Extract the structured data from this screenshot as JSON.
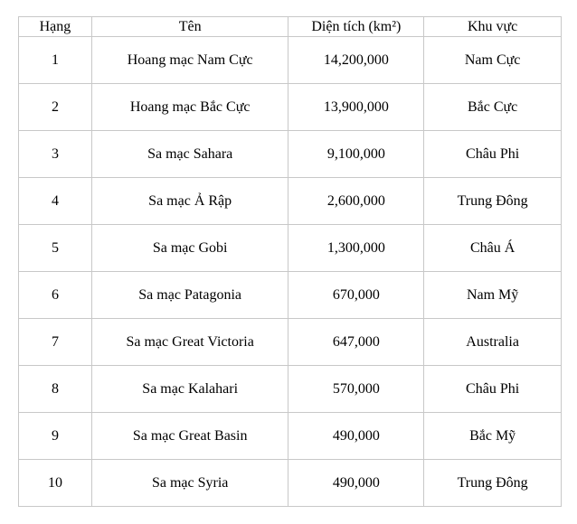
{
  "table": {
    "headers": [
      "Hạng",
      "Tên",
      "Diện tích (km²)",
      "Khu vực"
    ],
    "rows": [
      [
        "1",
        "Hoang mạc Nam Cực",
        "14,200,000",
        "Nam Cực"
      ],
      [
        "2",
        "Hoang mạc Bắc Cực",
        "13,900,000",
        "Bắc Cực"
      ],
      [
        "3",
        "Sa mạc Sahara",
        "9,100,000",
        "Châu Phi"
      ],
      [
        "4",
        "Sa mạc Ả Rập",
        "2,600,000",
        "Trung Đông"
      ],
      [
        "5",
        "Sa mạc Gobi",
        "1,300,000",
        "Châu Á"
      ],
      [
        "6",
        "Sa mạc Patagonia",
        "670,000",
        "Nam Mỹ"
      ],
      [
        "7",
        "Sa mạc Great Victoria",
        "647,000",
        "Australia"
      ],
      [
        "8",
        "Sa mạc Kalahari",
        "570,000",
        "Châu Phi"
      ],
      [
        "9",
        "Sa mạc Great Basin",
        "490,000",
        "Bắc Mỹ"
      ],
      [
        "10",
        "Sa mạc Syria",
        "490,000",
        "Trung Đông"
      ]
    ]
  }
}
